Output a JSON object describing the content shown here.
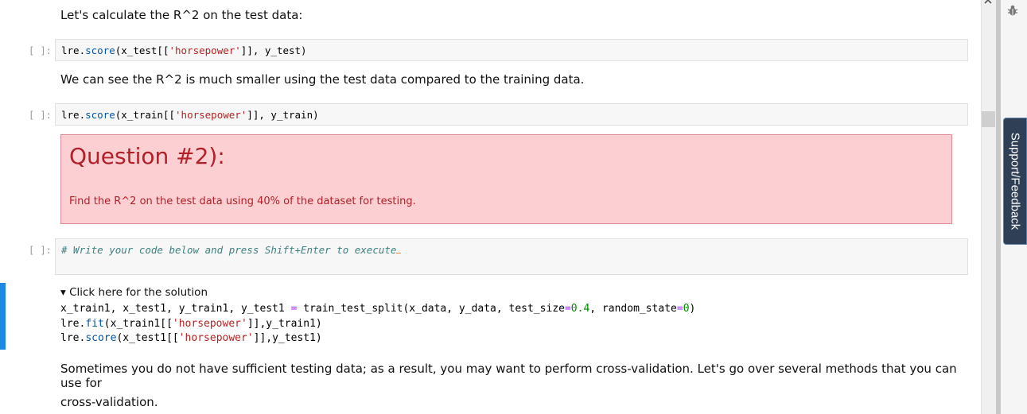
{
  "cells": {
    "intro_text": "Let's calculate the R^2 on the test data:",
    "prompt_label": "[ ]:",
    "code1": {
      "var": "lre",
      "dot": ".",
      "method": "score",
      "args_pre": "(x_test[[",
      "str": "'horsepower'",
      "args_post": "]], y_test)"
    },
    "middle_text": "We can see the R^2 is much smaller using the test data compared to the training data.",
    "code2": {
      "var": "lre",
      "dot": ".",
      "method": "score",
      "args_pre": "(x_train[[",
      "str": "'horsepower'",
      "args_post": "]], y_train)"
    },
    "question": {
      "title": "Question #2):",
      "body": "Find the R^2 on the test data using 40% of the dataset for testing."
    },
    "code3": {
      "comment": "# Write your code below and press Shift+Enter to execute"
    },
    "solution": {
      "summary": "▾ Click here for the solution",
      "line1_a": "x_train1, x_test1, y_train1, y_test1 ",
      "line1_eq": "=",
      "line1_b": " train_test_split(x_data, y_data, test_size",
      "line1_eq2": "=",
      "line1_num1": "0.4",
      "line1_c": ", random_state",
      "line1_eq3": "=",
      "line1_num2": "0",
      "line1_d": ")",
      "line2_a": "lre.",
      "line2_method": "fit",
      "line2_b": "(x_train1[[",
      "line2_str": "'horsepower'",
      "line2_c": "]],y_train1)",
      "line3_a": "lre.",
      "line3_method": "score",
      "line3_b": "(x_test1[[",
      "line3_str": "'horsepower'",
      "line3_c": "]],y_test1)"
    },
    "outro_text_1": "Sometimes you do not have sufficient testing data; as a result, you may want to perform cross-validation. Let's go over several methods that you can use for",
    "outro_text_2": "cross-validation."
  },
  "sidebar": {
    "support_label": "Support/Feedback",
    "debug_icon": "bug-icon"
  }
}
